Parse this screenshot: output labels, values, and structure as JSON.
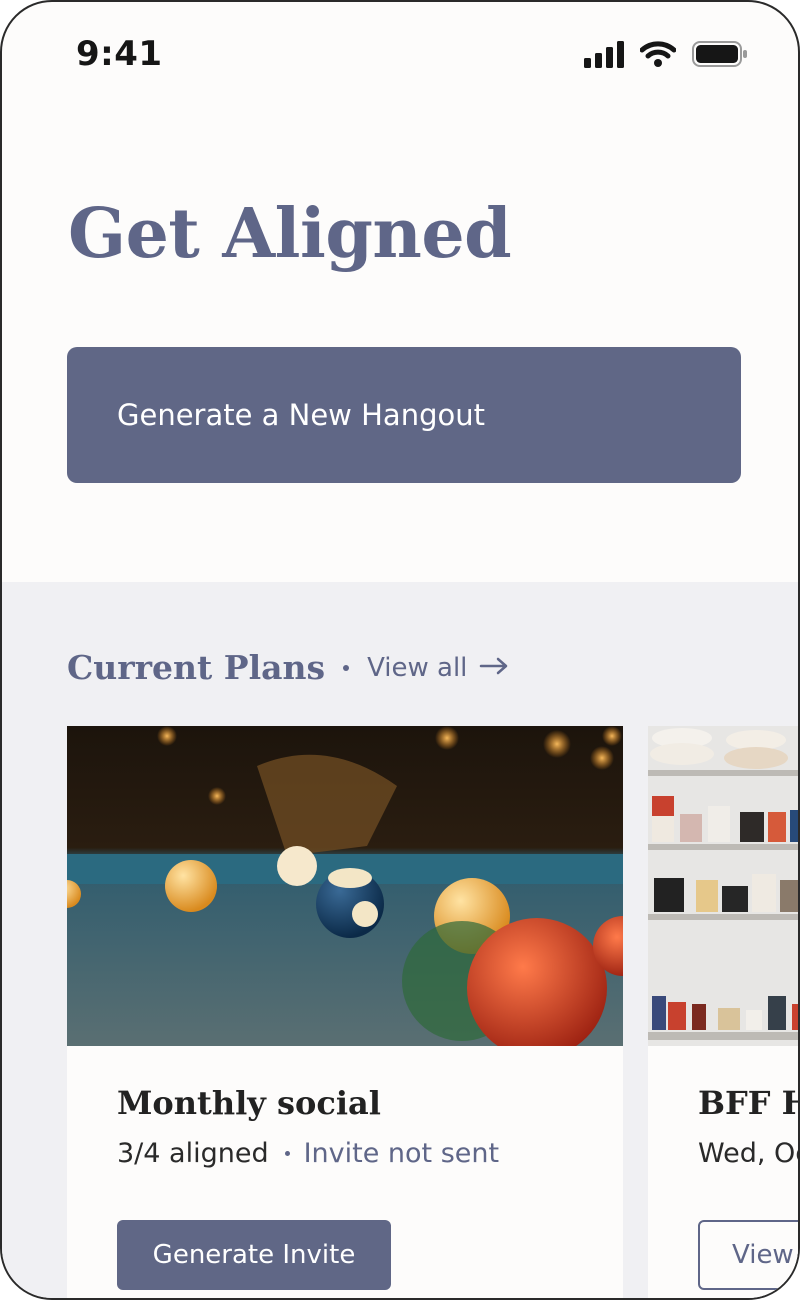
{
  "status_bar": {
    "time": "9:41"
  },
  "header": {
    "title": "Get Aligned"
  },
  "actions": {
    "generate_label": "Generate a New Hangout"
  },
  "current_plans": {
    "section_title": "Current Plans",
    "view_all_label": "View all",
    "cards": [
      {
        "title": "Monthly social",
        "aligned": "3/4 aligned",
        "invite_status": "Invite not sent",
        "button_label": "Generate Invite"
      },
      {
        "title": "BFF Ha",
        "date": "Wed, Oc",
        "button_label": "View"
      }
    ]
  },
  "colors": {
    "accent": "#606786",
    "heading": "#5f6688",
    "section_bg": "#f0f0f3",
    "page_bg": "#fdfcfb"
  },
  "icons": [
    "signal-icon",
    "wifi-icon",
    "battery-icon",
    "arrow-right-icon"
  ]
}
